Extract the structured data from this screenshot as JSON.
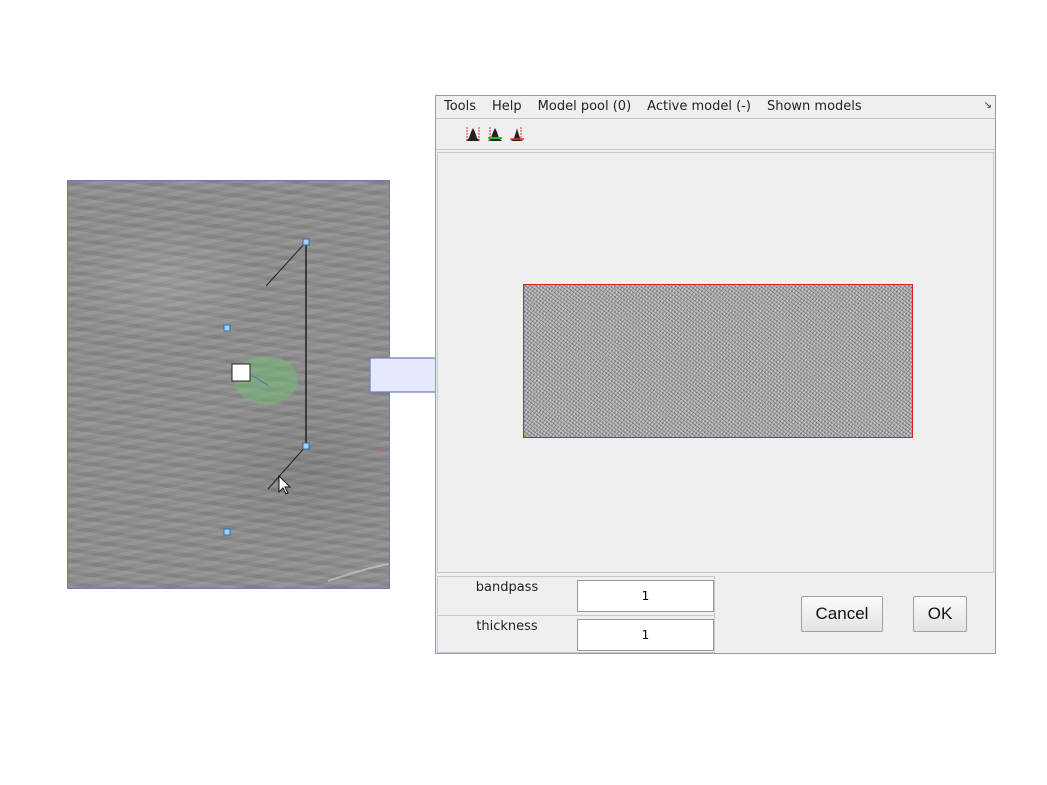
{
  "menu": {
    "items": [
      "Tools",
      "Help",
      "Model pool (0)",
      "Active model (-)",
      "Shown models"
    ],
    "corner_glyph": "↘"
  },
  "toolbar": {
    "icons": [
      "histogram-dark-icon",
      "histogram-green-icon",
      "histogram-red-icon"
    ]
  },
  "params": {
    "bandpass_label": "bandpass",
    "bandpass_value": "1",
    "thickness_label": "thickness",
    "thickness_value": "1"
  },
  "buttons": {
    "cancel": "Cancel",
    "ok": "OK"
  },
  "colors": {
    "preview_border": "#d92020",
    "handle": "#5aa0e6",
    "selection_fill": "#6fc46f",
    "arrow_fill": "#e6e9fb",
    "arrow_stroke": "#6f7fc0"
  }
}
